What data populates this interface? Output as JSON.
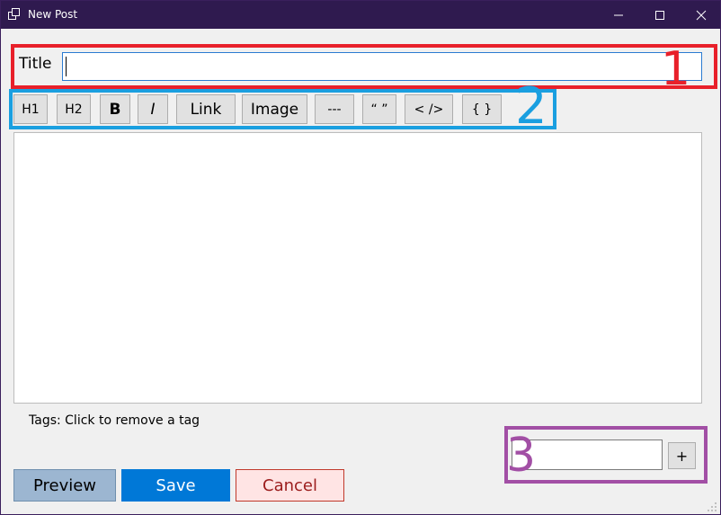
{
  "window": {
    "title": "New Post",
    "controls": [
      "minimize-icon",
      "maximize-icon",
      "close-icon"
    ]
  },
  "form": {
    "title_label": "Title",
    "title_value": "",
    "toolbar": [
      "H1",
      "H2",
      "B",
      "I",
      "Link",
      "Image",
      "---",
      "“ ”",
      "< />",
      "{ }"
    ],
    "tags_label": "Tags: Click to remove a tag",
    "tag_value": "",
    "add_tag_label": "+"
  },
  "actions": {
    "preview": "Preview",
    "save": "Save",
    "cancel": "Cancel"
  },
  "annotations": {
    "box1": {
      "number": "1",
      "color": "#e8202a"
    },
    "box2": {
      "number": "2",
      "color": "#1a9fe0"
    },
    "box3": {
      "number": "3",
      "color": "#a24fa5"
    }
  },
  "colors": {
    "titlebar": "#2f1a4f",
    "save": "#0078d7",
    "preview": "#9cb6d1",
    "cancel_bg": "#ffe4e4",
    "cancel_text": "#9b1c1c",
    "focus_border": "#2b7bd1"
  }
}
